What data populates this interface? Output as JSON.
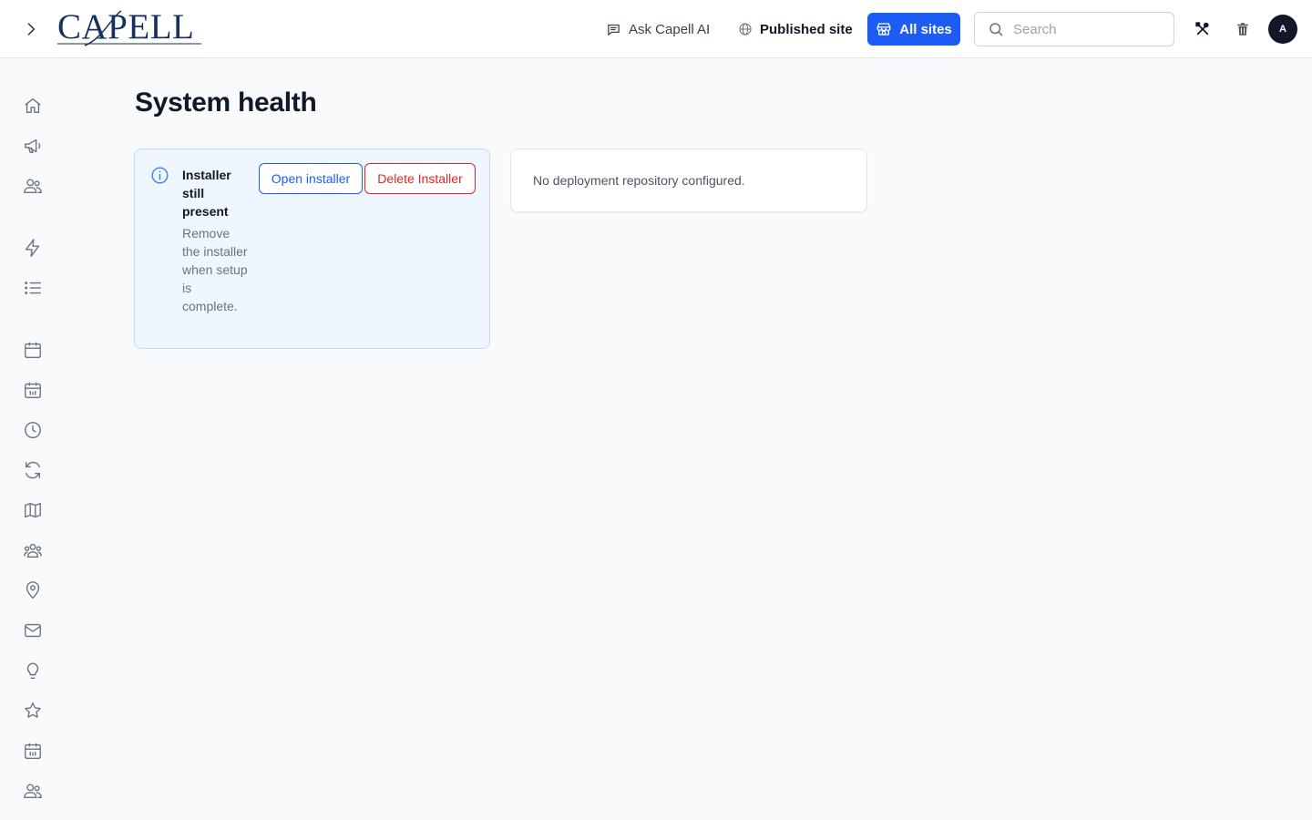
{
  "header": {
    "logo_text": "CAPELL",
    "ask_ai_label": "Ask Capell AI",
    "published_site_label": "Published site",
    "all_sites_label": "All sites",
    "search_placeholder": "Search",
    "avatar_initial": "A"
  },
  "sidebar": {
    "items": [
      {
        "icon": "home-icon"
      },
      {
        "icon": "megaphone-icon"
      },
      {
        "icon": "users-icon"
      },
      {
        "icon": "lightning-icon"
      },
      {
        "icon": "list-icon"
      },
      {
        "icon": "calendar-icon"
      },
      {
        "icon": "calendar-grid-icon"
      },
      {
        "icon": "clock-icon"
      },
      {
        "icon": "refresh-icon"
      },
      {
        "icon": "map-icon"
      },
      {
        "icon": "user-group-icon"
      },
      {
        "icon": "map-pin-icon"
      },
      {
        "icon": "mail-icon"
      },
      {
        "icon": "lightbulb-icon"
      },
      {
        "icon": "star-icon"
      },
      {
        "icon": "calendar-grid-icon"
      },
      {
        "icon": "users-icon"
      }
    ]
  },
  "main": {
    "title": "System health",
    "alert": {
      "title": "Installer still present",
      "description": "Remove the installer when setup is complete.",
      "open_label": "Open installer",
      "delete_label": "Delete Installer"
    },
    "repo_message": "No deployment repository configured."
  },
  "colors": {
    "accent": "#1d5cf5",
    "danger": "#dc2626",
    "alert_bg": "#eff6ff",
    "logo": "#16325c"
  }
}
